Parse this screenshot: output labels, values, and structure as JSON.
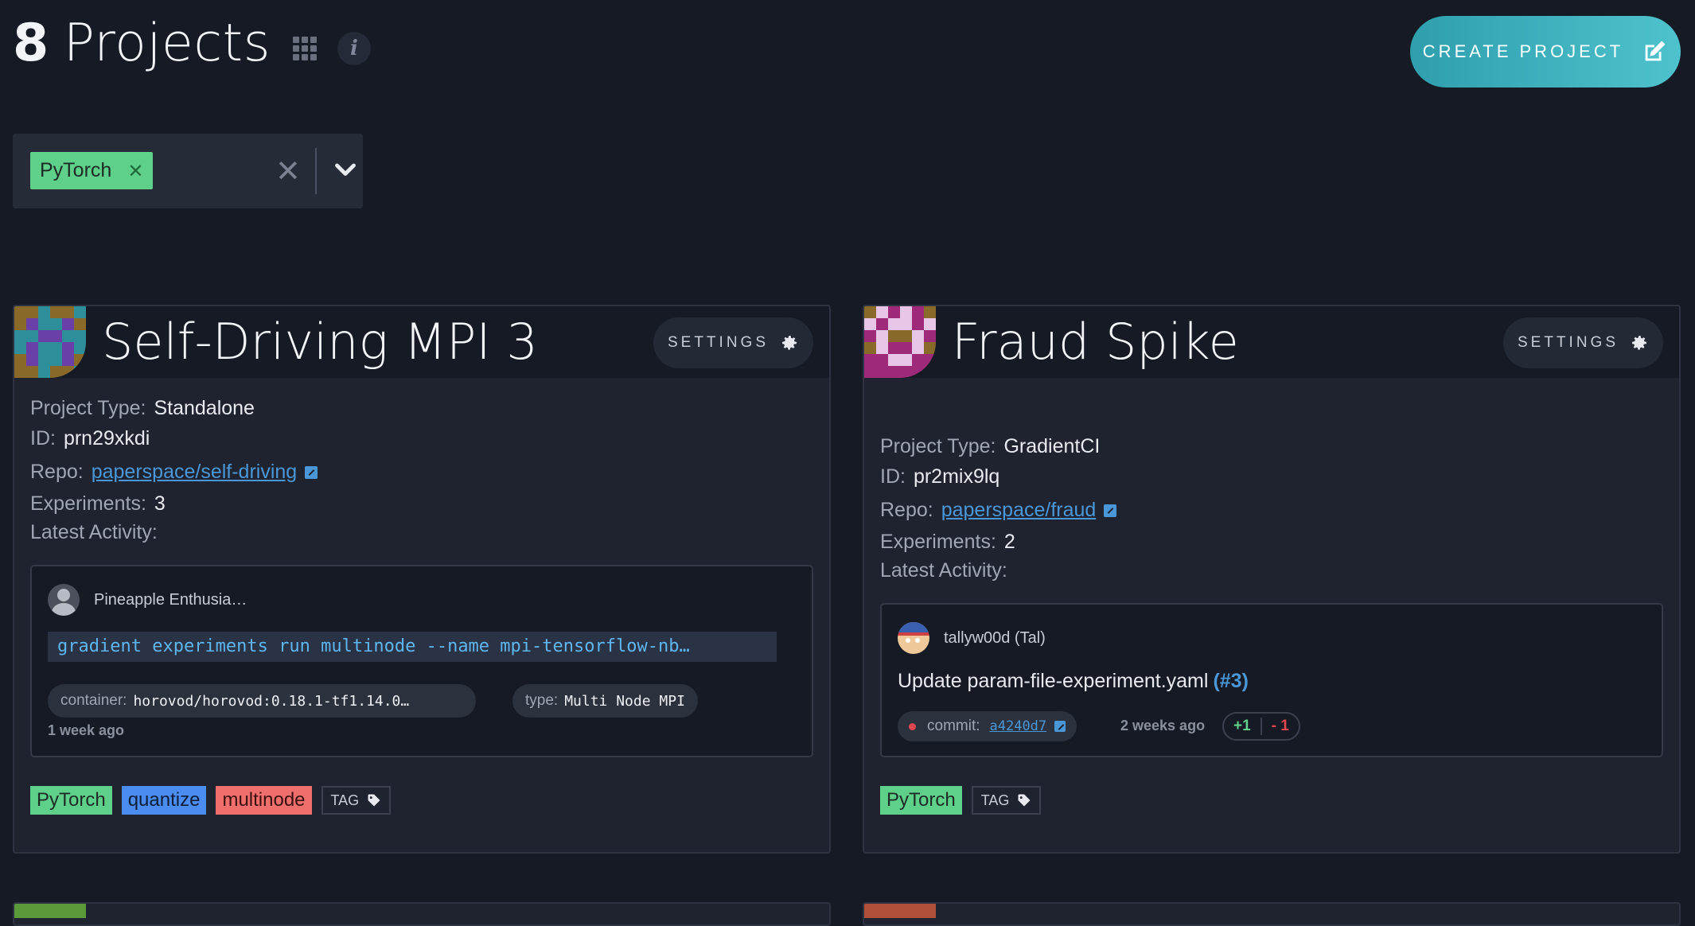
{
  "header": {
    "count": "8",
    "title": "Projects",
    "create_label": "CREATE PROJECT"
  },
  "filter": {
    "chip_label": "PyTorch"
  },
  "projects": [
    {
      "title": "Self-Driving MPI 3",
      "settings_label": "SETTINGS",
      "type_label": "Project Type:",
      "type_value": "Standalone",
      "id_label": "ID:",
      "id_value": "prn29xkdi",
      "repo_label": "Repo:",
      "repo_value": "paperspace/self-driving",
      "experiments_label": "Experiments:",
      "experiments_value": "3",
      "activity_label": "Latest Activity:",
      "activity": {
        "user": "Pineapple Enthusia…",
        "command": "gradient experiments run multinode --name mpi-tensorflow-nb…",
        "container_key": "container:",
        "container_value": "horovod/horovod:0.18.1-tf1.14.0…",
        "type_key": "type:",
        "type_value": "Multi Node MPI",
        "time": "1 week ago"
      },
      "tags": [
        "PyTorch",
        "quantize",
        "multinode"
      ],
      "tag_button": "TAG"
    },
    {
      "title": "Fraud Spike",
      "settings_label": "SETTINGS",
      "type_label": "Project Type:",
      "type_value": "GradientCI",
      "id_label": "ID:",
      "id_value": "pr2mix9lq",
      "repo_label": "Repo:",
      "repo_value": "paperspace/fraud",
      "experiments_label": "Experiments:",
      "experiments_value": "2",
      "activity_label": "Latest Activity:",
      "activity": {
        "user": "tallyw00d (Tal)",
        "message": "Update param-file-experiment.yaml",
        "message_ref": "(#3)",
        "commit_key": "commit:",
        "commit_value": "a4240d7",
        "time": "2 weeks ago",
        "additions": "+1",
        "deletions": "- 1"
      },
      "tags": [
        "PyTorch"
      ],
      "tag_button": "TAG"
    }
  ],
  "colors": {
    "background": "#161a24",
    "card": "#1f2330",
    "accent_teal": "#3fb3c0",
    "link_blue": "#4a97d8",
    "tag_green": "#5fd08a",
    "tag_blue": "#4a8cf0",
    "tag_red": "#ef6f6c"
  },
  "icons": {
    "grid": "grid-icon",
    "info": "info-icon",
    "create": "edit-icon",
    "settings": "gear-icon",
    "external": "external-link-icon",
    "tag": "tag-icon",
    "clear": "close-icon",
    "dropdown": "chevron-down-icon"
  }
}
